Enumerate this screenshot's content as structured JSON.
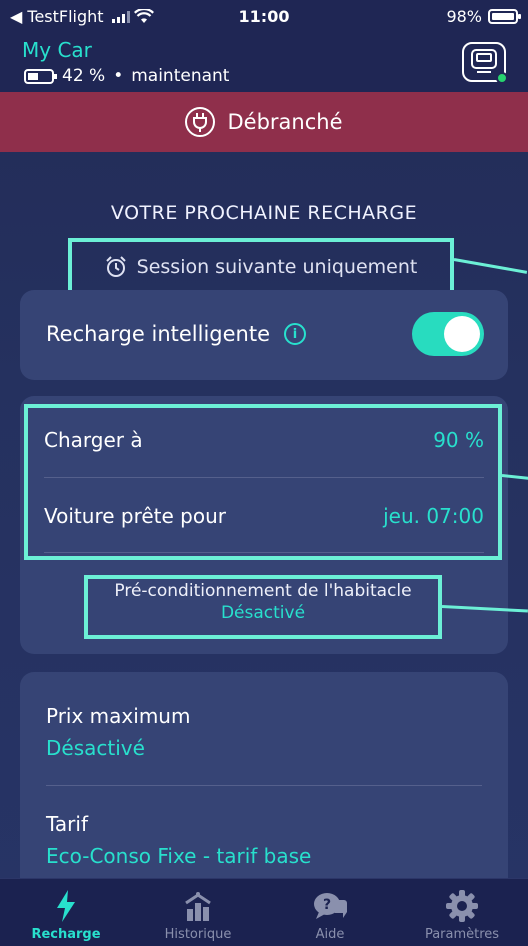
{
  "status_bar": {
    "back_app": "◀ TestFlight",
    "time": "11:00",
    "battery": "98%"
  },
  "header": {
    "car_name": "My Car",
    "battery_percent": "42 %",
    "separator": "•",
    "updated": "maintenant"
  },
  "banner": {
    "label": "Débranché"
  },
  "next_charge": {
    "title": "VOTRE PROCHAINE RECHARGE",
    "session_mode": "Session suivante uniquement"
  },
  "smart_charging": {
    "label": "Recharge intelligente",
    "enabled": true
  },
  "charge_settings": {
    "charge_to_label": "Charger à",
    "charge_to_value": "90 %",
    "ready_by_label": "Voiture prête pour",
    "ready_by_value": "jeu. 07:00",
    "precond_label": "Pré-conditionnement de l'habitacle",
    "precond_value": "Désactivé"
  },
  "pricing": {
    "max_price_label": "Prix maximum",
    "max_price_value": "Désactivé",
    "tariff_label": "Tarif",
    "tariff_value": "Eco-Conso Fixe - tarif base"
  },
  "tabs": [
    {
      "label": "Recharge",
      "icon": "bolt-icon",
      "active": true
    },
    {
      "label": "Historique",
      "icon": "history-icon",
      "active": false
    },
    {
      "label": "Aide",
      "icon": "help-chat-icon",
      "active": false
    },
    {
      "label": "Paramètres",
      "icon": "gear-icon",
      "active": false
    }
  ],
  "colors": {
    "accent": "#28e0cd",
    "banner": "#8f2f4b",
    "highlight": "#6cf0d6"
  }
}
